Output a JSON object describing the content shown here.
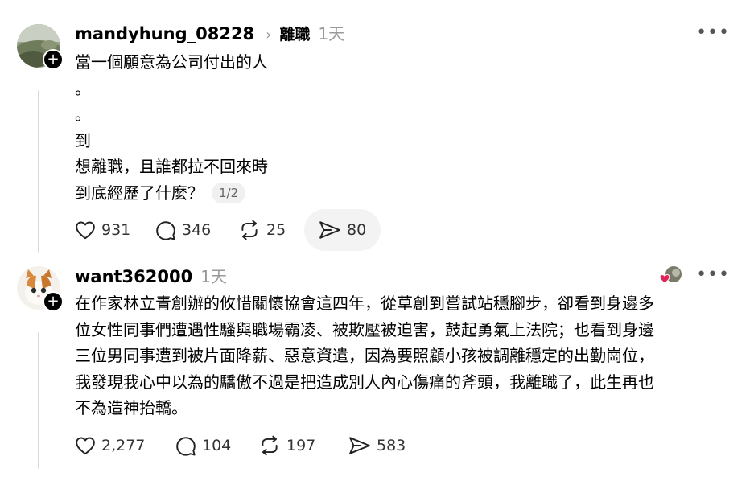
{
  "posts": [
    {
      "username": "mandyhung_08228",
      "topic": "離職",
      "time": "1天",
      "lines": [
        "當一個願意為公司付出的人",
        "。",
        "。",
        "到",
        "想離職，且誰都拉不回來時",
        "到底經歷了什麼？"
      ],
      "page_indicator": "1/2",
      "likes": "931",
      "comments": "346",
      "reposts": "25",
      "shares": "80"
    },
    {
      "username": "want362000",
      "time": "1天",
      "lines": [
        "在作家林立青創辦的攸惜關懷協會這四年，從草創到嘗試站穩腳步，卻看到身邊多",
        "位女性同事們遭遇性騷與職場霸凌、被欺壓被迫害，鼓起勇氣上法院；也看到身邊",
        "三位男同事遭到被片面降薪、惡意資遣，因為要照顧小孩被調離穩定的出勤崗位，",
        "我發現我心中以為的驕傲不過是把造成別人內心傷痛的斧頭，我離職了，此生再也",
        "不為造神抬轎。"
      ],
      "likes": "2,277",
      "comments": "104",
      "reposts": "197",
      "shares": "583"
    }
  ],
  "icons": {
    "more": "more-horizontal-icon",
    "like": "heart-icon",
    "comment": "comment-bubble-icon",
    "repost": "repost-icon",
    "share": "send-icon",
    "follow": "plus-icon"
  },
  "colors": {
    "secondary_text": "#999999",
    "thread_line": "#d9d9d9",
    "like_red": "#e0245e"
  }
}
